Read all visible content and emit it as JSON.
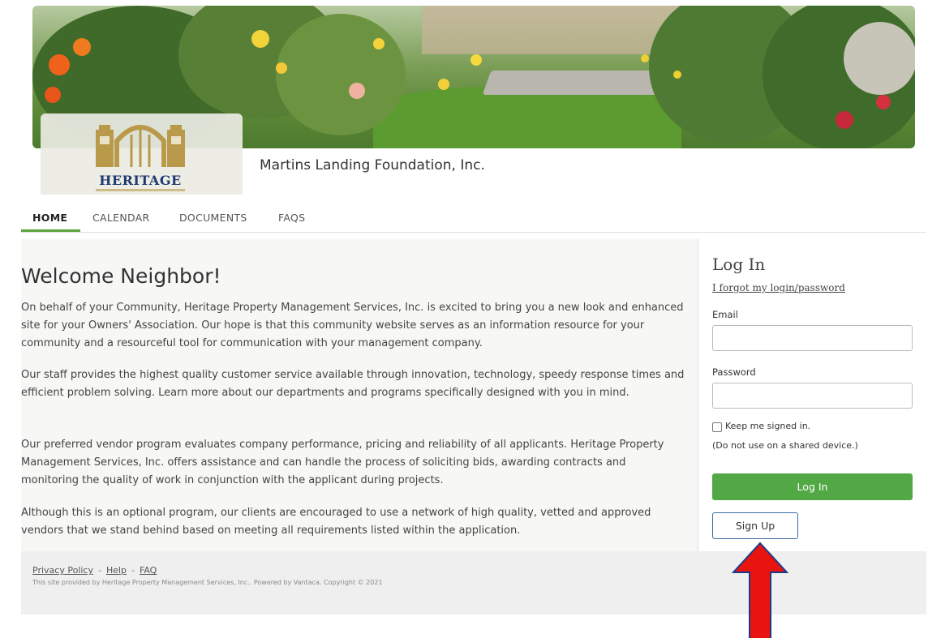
{
  "org": {
    "logo_text": "HERITAGE",
    "name": "Martins Landing Foundation, Inc."
  },
  "nav": {
    "items": [
      {
        "label": "HOME"
      },
      {
        "label": "CALENDAR"
      },
      {
        "label": "DOCUMENTS"
      },
      {
        "label": "FAQS"
      }
    ],
    "active": "HOME"
  },
  "main": {
    "title": "Welcome Neighbor!",
    "paragraphs": [
      "On behalf of your Community, Heritage Property Management Services, Inc. is excited to bring you a new look and enhanced site for your Owners' Association. Our hope is that this community website serves as an information resource for your community and a resourceful tool for communication with your management company.",
      "Our staff provides the highest quality customer service available through innovation, technology, speedy response times and efficient problem solving. Learn more about our departments and programs specifically designed with you in mind.",
      "Our preferred vendor program evaluates company performance, pricing and reliability of all applicants. Heritage Property Management Services, Inc. offers assistance and can handle the process of soliciting bids, awarding contracts and monitoring the quality of work in conjunction with the applicant during projects.",
      "Although this is an optional program, our clients are encouraged to use a network of high quality, vetted and approved vendors that we stand behind based on meeting all requirements listed within the application."
    ]
  },
  "login": {
    "title": "Log In",
    "forgot": "I forgot my login/password",
    "email_label": "Email",
    "email_value": "",
    "password_label": "Password",
    "password_value": "",
    "keep_signed_in": "Keep me signed in.",
    "note": "(Do not use on a shared device.)",
    "login_button": "Log In",
    "signup_button": "Sign Up"
  },
  "footer": {
    "links": [
      "Privacy Policy",
      "Help",
      "FAQ"
    ],
    "separator": "-",
    "copyright": "This site provided by Heritage Property Management Services, Inc.. Powered by Vantaca. Copyright © 2021"
  },
  "colors": {
    "accent_green": "#52a845",
    "annotation_arrow": "#e8140f",
    "logo_navy": "#1f3a70",
    "logo_gold": "#b89a4a"
  }
}
